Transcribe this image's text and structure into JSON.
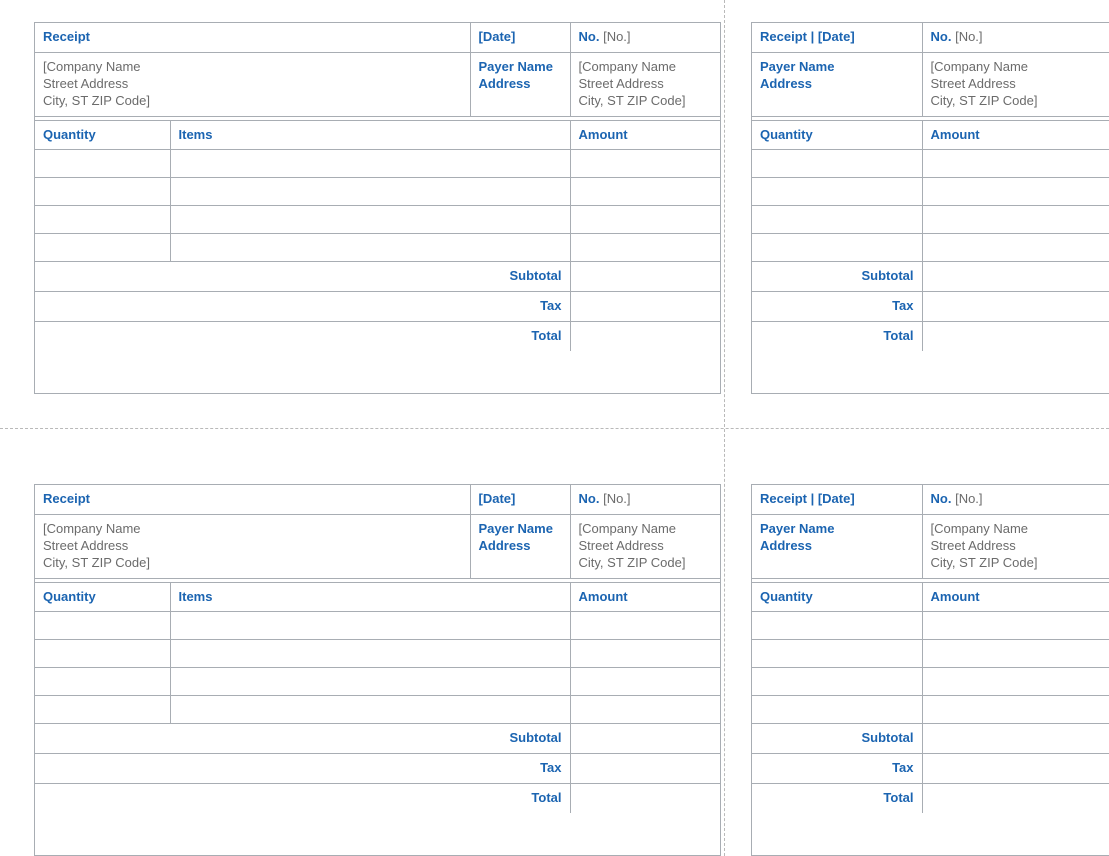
{
  "labels": {
    "receipt": "Receipt",
    "receipt_date": "Receipt | [Date]",
    "date": "[Date]",
    "no": "No.",
    "no_val": "[No.]",
    "payer_name": "Payer Name",
    "address": "Address",
    "company_line1": "[Company Name",
    "company_line2": "Street Address",
    "company_line3": "City, ST ZIP Code]",
    "quantity": "Quantity",
    "items": "Items",
    "amount": "Amount",
    "subtotal": "Subtotal",
    "tax": "Tax",
    "total": "Total"
  }
}
